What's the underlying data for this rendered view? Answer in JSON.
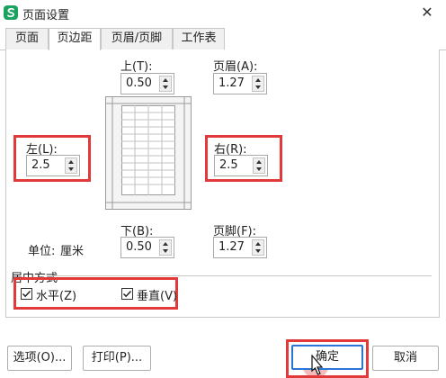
{
  "window": {
    "title": "页面设置",
    "icon": "wps-sheet-icon",
    "accent": "#1aa260"
  },
  "tabs": [
    {
      "label": "页面",
      "active": false
    },
    {
      "label": "页边距",
      "active": true
    },
    {
      "label": "页眉/页脚",
      "active": false
    },
    {
      "label": "工作表",
      "active": false
    }
  ],
  "margins": {
    "top": {
      "label": "上(T):",
      "value": "0.50"
    },
    "header": {
      "label": "页眉(A):",
      "value": "1.27"
    },
    "left": {
      "label": "左(L):",
      "value": "2.5"
    },
    "right": {
      "label": "右(R):",
      "value": "2.5"
    },
    "bottom": {
      "label": "下(B):",
      "value": "0.50"
    },
    "footer": {
      "label": "页脚(F):",
      "value": "1.27"
    }
  },
  "unit": {
    "label": "单位:",
    "value": "厘米"
  },
  "center": {
    "title": "居中方式",
    "horizontal": {
      "label": "水平(Z)",
      "checked": true
    },
    "vertical": {
      "label": "垂直(V)",
      "checked": true
    }
  },
  "buttons": {
    "options": "选项(O)...",
    "print": "打印(P)...",
    "ok": "确定",
    "cancel": "取消"
  },
  "highlight_color": "#e23a3a",
  "primary_border_color": "#2b74d8"
}
